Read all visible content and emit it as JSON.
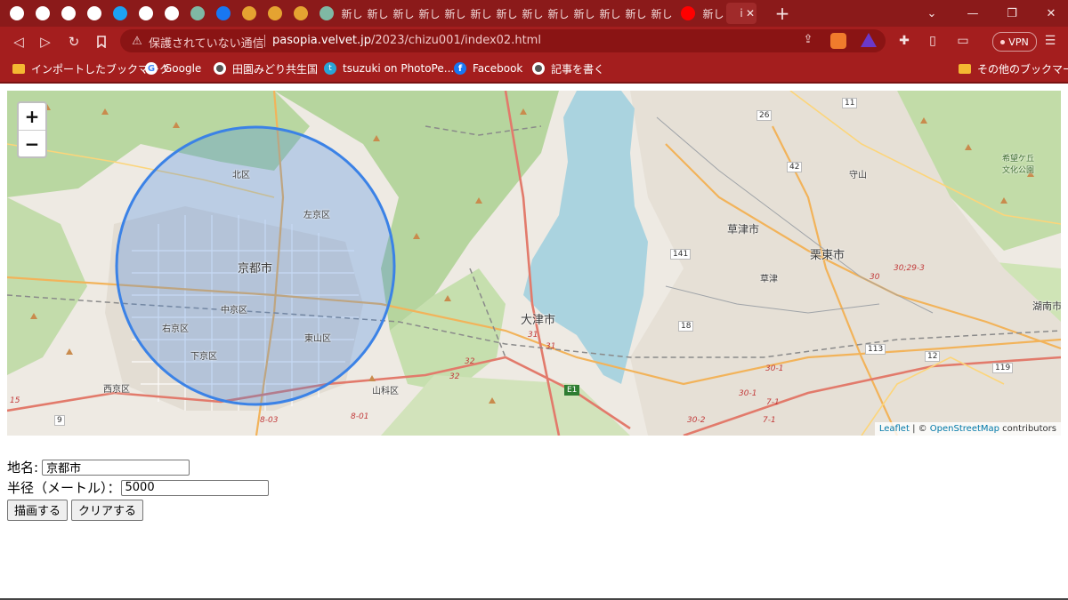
{
  "browser": {
    "tabs": [
      {
        "label": "",
        "icon": "globe-icon"
      },
      {
        "label": "",
        "icon": "globe-icon"
      },
      {
        "label": "",
        "icon": "globe-icon"
      },
      {
        "label": "",
        "icon": "globe-icon"
      },
      {
        "label": "",
        "icon": "twitter-icon"
      },
      {
        "label": "",
        "icon": "opera-icon"
      },
      {
        "label": "",
        "icon": "opera-icon"
      },
      {
        "label": "",
        "icon": "chatgpt-icon"
      },
      {
        "label": "",
        "icon": "facebook-icon"
      },
      {
        "label": "",
        "icon": "site-icon"
      },
      {
        "label": "",
        "icon": "site-icon"
      },
      {
        "label": "",
        "icon": "site-icon"
      },
      {
        "label": "",
        "icon": "chatgpt-icon"
      },
      {
        "label": "新し",
        "icon": ""
      },
      {
        "label": "新し",
        "icon": ""
      },
      {
        "label": "新し",
        "icon": ""
      },
      {
        "label": "新し",
        "icon": ""
      },
      {
        "label": "新し",
        "icon": ""
      },
      {
        "label": "新し",
        "icon": ""
      },
      {
        "label": "新し",
        "icon": ""
      },
      {
        "label": "新し",
        "icon": ""
      },
      {
        "label": "新し",
        "icon": ""
      },
      {
        "label": "新し",
        "icon": ""
      },
      {
        "label": "新し",
        "icon": ""
      },
      {
        "label": "新し",
        "icon": ""
      },
      {
        "label": "新し",
        "icon": ""
      },
      {
        "label": "",
        "icon": "youtube-icon"
      },
      {
        "label": "新し",
        "icon": ""
      },
      {
        "label": "i",
        "icon": "",
        "active": true
      }
    ],
    "tab_close": "✕",
    "new_tab": "+",
    "address": {
      "security_text": "保護されていない通信",
      "domain": "pasopia.velvet.jp",
      "path": "/2023/chizu001/index02.html"
    },
    "vpn_label": "VPN",
    "bookmarks": [
      {
        "label": "インポートしたブックマーク",
        "icon": "folder-icon"
      },
      {
        "label": "Google",
        "icon": "google-icon"
      },
      {
        "label": "田園みどり共生国",
        "icon": "globe-icon"
      },
      {
        "label": "tsuzuki on PhotoPe...",
        "icon": "photopea-icon"
      },
      {
        "label": "Facebook",
        "icon": "facebook-icon"
      },
      {
        "label": "記事を書く",
        "icon": "globe-icon"
      }
    ],
    "other_bookmarks": "その他のブックマーク"
  },
  "map": {
    "zoom_in": "+",
    "zoom_out": "−",
    "attribution": {
      "leaflet": "Leaflet",
      "sep": " | © ",
      "osm": "OpenStreetMap",
      "tail": " contributors"
    },
    "labels": {
      "kyoto": "京都市",
      "kita": "北区",
      "sakyo": "左京区",
      "nakagyo": "中京区",
      "ukyo": "右京区",
      "shimogyo": "下京区",
      "higashiyama": "東山区",
      "nishikyo": "西京区",
      "yamashina": "山科区",
      "otsu": "大津市",
      "kusatsu": "草津市",
      "kusatsu_small": "草津",
      "ritto": "栗東市",
      "moriyama": "守山",
      "konan": "湖南市",
      "park": "希望ケ丘\n文化公園"
    },
    "road_numbers": [
      "26",
      "11",
      "42",
      "141",
      "18",
      "113",
      "12",
      "119",
      "9",
      "E1"
    ],
    "road_italic": [
      "30;29-3",
      "30",
      "31",
      "31",
      "32",
      "32",
      "8-03",
      "8-01",
      "30-2",
      "30-1",
      "30-1",
      "7-1",
      "7-1",
      "15"
    ],
    "circle": {
      "radius_m": 5000,
      "stroke": "#3b82e6",
      "fill": "rgba(59,130,230,0.28)"
    }
  },
  "form": {
    "place_label": "地名:",
    "place_value": "京都市",
    "radius_label": "半径（メートル）：",
    "radius_value": "5000",
    "draw_button": "描画する",
    "clear_button": "クリアする"
  }
}
